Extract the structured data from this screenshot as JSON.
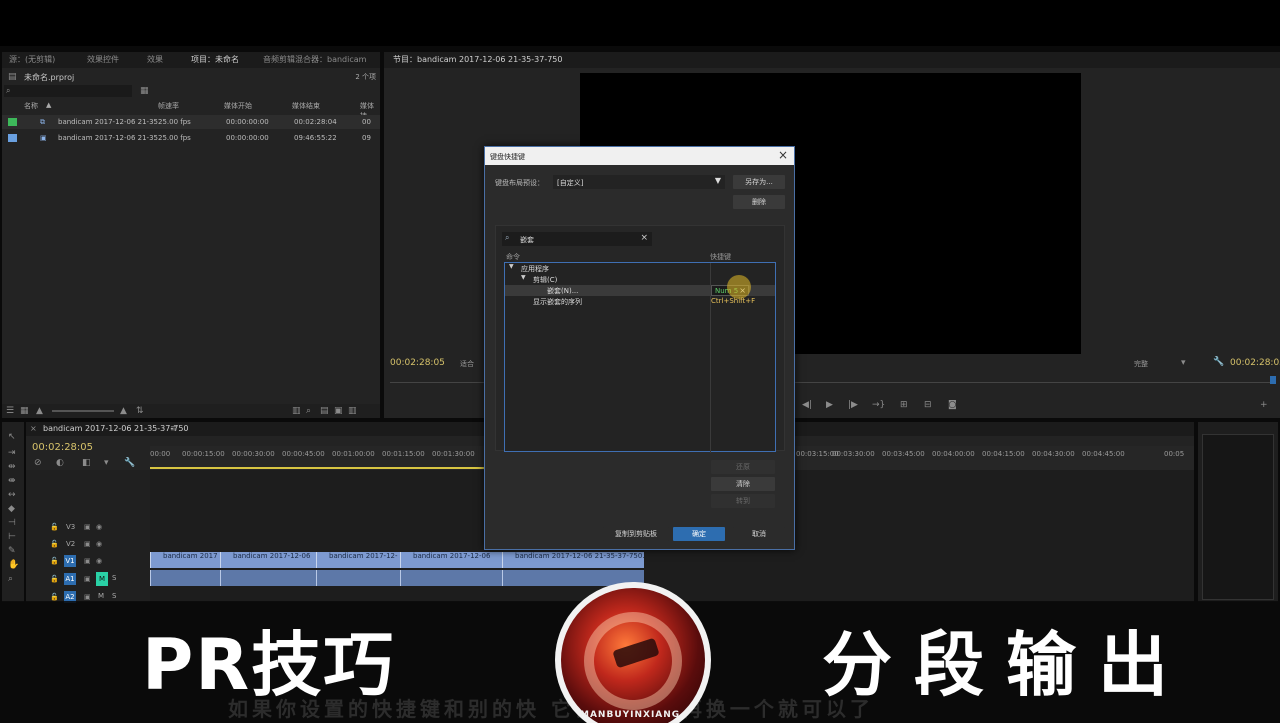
{
  "project_panel": {
    "tabs": [
      "源：(无剪辑)",
      "效果控件",
      "效果",
      "项目：未命名",
      "音频剪辑混合器：bandicam"
    ],
    "project_file": "未命名.prproj",
    "item_count": "2 个项",
    "columns": [
      "名称",
      "帧速率",
      "媒体开始",
      "媒体结束",
      "媒体持"
    ],
    "items": [
      {
        "name": "bandicam 2017-12-06 21-35",
        "fps": "25.00 fps",
        "start": "00:00:00:00",
        "end": "00:02:28:04",
        "dur": "00",
        "color": "#3db85a"
      },
      {
        "name": "bandicam 2017-12-06 21-35",
        "fps": "25.00 fps",
        "start": "00:00:00:00",
        "end": "09:46:55:22",
        "dur": "09",
        "color": "#6aa0e0"
      }
    ]
  },
  "program_monitor": {
    "tab": "节目：bandicam 2017-12-06 21-35-37-750",
    "timecode_left": "00:02:28:05",
    "fit": "适合",
    "quality": "完整",
    "timecode_right": "00:02:28:05"
  },
  "timeline": {
    "tab": "bandicam 2017-12-06 21-35-37-750",
    "timecode": "00:02:28:05",
    "ticks": [
      "00:00",
      "00:00:15:00",
      "00:00:30:00",
      "00:00:45:00",
      "00:01:00:00",
      "00:01:15:00",
      "00:01:30:00",
      "00:03:15:00",
      "00:03:30:00",
      "00:03:45:00",
      "00:04:00:00",
      "00:04:15:00",
      "00:04:30:00",
      "00:04:45:00",
      "00:05"
    ],
    "tracks": [
      "V3",
      "V2",
      "V1",
      "A1",
      "A2",
      "A3",
      "主声道"
    ],
    "master_value": "0.0",
    "clip_labels": [
      "bandicam 2017",
      "bandicam 2017-12-06",
      "bandicam 2017-12-",
      "bandicam 2017-12-06",
      "bandicam 2017-12-06 21-35-37-750.m"
    ]
  },
  "dialog": {
    "title": "键盘快捷键",
    "preset_label": "键盘布局预设：",
    "preset_value": "[自定义]",
    "save_as": "另存为...",
    "delete": "删除",
    "search_value": "嵌套",
    "col_command": "命令",
    "col_shortcut": "快捷键",
    "tree": [
      {
        "label": "应用程序",
        "level": 0,
        "expand": true,
        "shortcut": ""
      },
      {
        "label": "剪辑(C)",
        "level": 1,
        "expand": true,
        "shortcut": ""
      },
      {
        "label": "嵌套(N)...",
        "level": 2,
        "expand": false,
        "shortcut": "Num 5"
      },
      {
        "label": "显示嵌套的序列",
        "level": 1,
        "expand": false,
        "shortcut": "Ctrl+Shift+F"
      }
    ],
    "undo": "还原",
    "clear": "清除",
    "goto": "转到",
    "copy_clipboard": "复制到剪贴板",
    "ok": "确定",
    "cancel": "取消"
  },
  "overlay": {
    "left_title": "PR技巧",
    "right_title": "分段输出",
    "subtitle": "如果你设置的快捷键和别的快          它会有提示 再换一个就可以了",
    "logo_text": "MANBUYINXIANG"
  },
  "colors": {
    "accent": "#2d6db0",
    "panel": "#232323",
    "dialog": "#2b2b2b"
  }
}
